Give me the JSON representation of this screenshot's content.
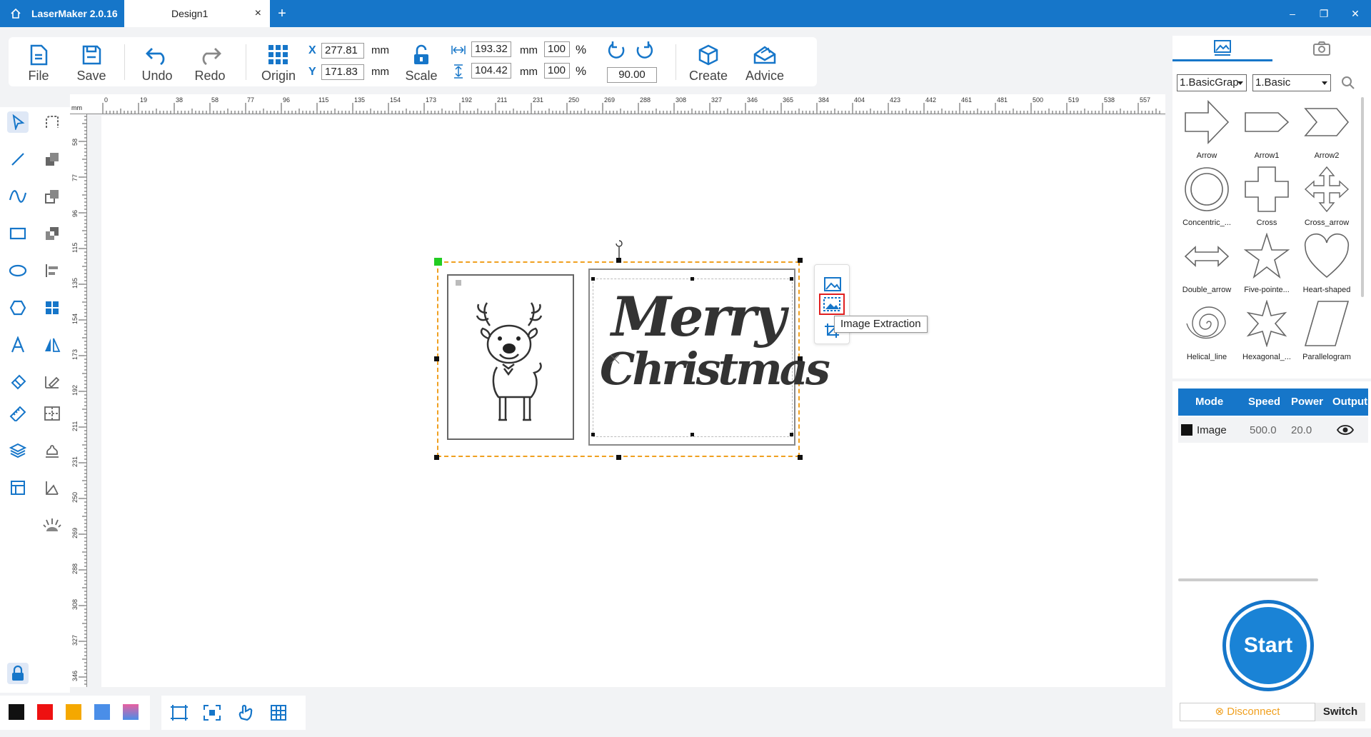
{
  "window": {
    "app_title": "LaserMaker 2.0.16",
    "tab_title": "Design1",
    "tab_close": "×",
    "new_tab": "+",
    "minimize": "–",
    "restore": "❐",
    "close": "✕"
  },
  "toolbar": {
    "file": "File",
    "save": "Save",
    "undo": "Undo",
    "redo": "Redo",
    "origin": "Origin",
    "scale": "Scale",
    "create": "Create",
    "advice": "Advice",
    "x_label": "X",
    "y_label": "Y",
    "x_value": "277.81",
    "y_value": "171.83",
    "width_value": "193.32",
    "height_value": "104.42",
    "width_pct": "100",
    "height_pct": "100",
    "unit": "mm",
    "pct_unit": "%",
    "rotation_value": "90.00"
  },
  "rulers": {
    "unit": "mm",
    "h_ticks": [
      "0",
      "19",
      "38",
      "58",
      "77",
      "96",
      "115",
      "135",
      "154",
      "173",
      "192",
      "211",
      "231",
      "250",
      "269",
      "288",
      "308",
      "327",
      "346",
      "365",
      "384",
      "404",
      "423",
      "442",
      "461",
      "481",
      "500",
      "519",
      "538",
      "557"
    ],
    "v_ticks": [
      "58",
      "77",
      "96",
      "115",
      "135",
      "154",
      "173",
      "192",
      "211",
      "231",
      "250",
      "269",
      "288",
      "308",
      "327",
      "346"
    ]
  },
  "canvas": {
    "image_left_caption": "",
    "image_right_line1": "Merry",
    "image_right_line2": "Christmas",
    "tooltip": "Image Extraction"
  },
  "colors": {
    "accent": "#1676c9",
    "selection": "#f0a020",
    "swatches": [
      "#111111",
      "#ee1111",
      "#f5a800",
      "#4a8ee8",
      "#e860a0"
    ]
  },
  "library": {
    "category_select": "1.BasicGrap",
    "sub_select": "1.Basic",
    "shapes": [
      "Arrow",
      "Arrow1",
      "Arrow2",
      "Concentric_...",
      "Cross",
      "Cross_arrow",
      "Double_arrow",
      "Five-pointe...",
      "Heart-shaped",
      "Helical_line",
      "Hexagonal_...",
      "Parallelogram"
    ]
  },
  "layers": {
    "headers": [
      "Mode",
      "Speed",
      "Power",
      "Output"
    ],
    "rows": [
      {
        "mode": "Image",
        "speed": "500.0",
        "power": "20.0",
        "color": "#111111"
      }
    ]
  },
  "device": {
    "start": "Start",
    "disconnect": "Disconnect",
    "disconnect_icon": "⊗",
    "switch": "Switch"
  }
}
